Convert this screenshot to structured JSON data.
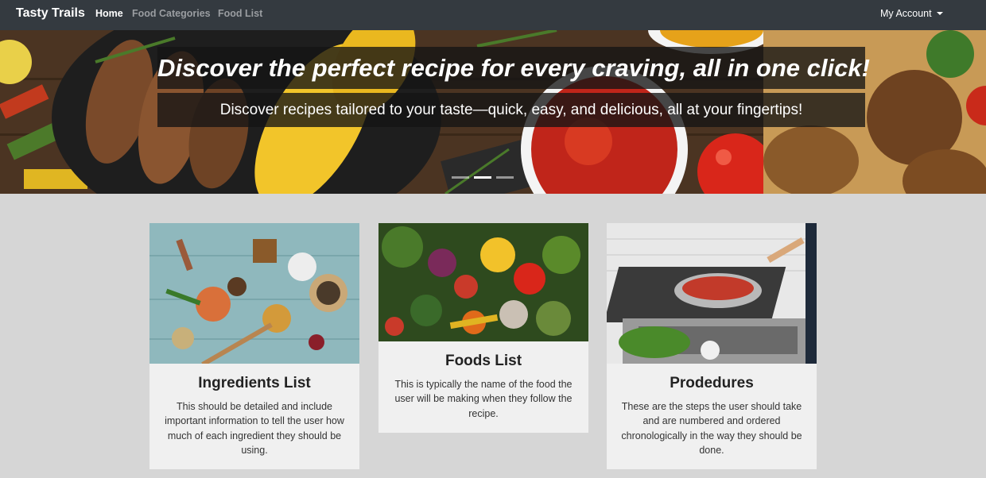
{
  "navbar": {
    "brand": "Tasty Trails",
    "links": [
      {
        "label": "Home",
        "active": true
      },
      {
        "label": "Food Categories",
        "active": false
      },
      {
        "label": "Food List",
        "active": false
      }
    ],
    "account_label": "My Account"
  },
  "hero": {
    "title": "Discover the perfect recipe for every craving, all in one click!",
    "subtitle": "Discover recipes tailored to your taste—quick, easy, and delicious, all at your fingertips!",
    "slide_count": 3,
    "active_slide": 1
  },
  "cards": [
    {
      "title": "Ingredients List",
      "text": "This should be detailed and include important information to tell the user how much of each ingredient they should be using.",
      "image_icon": "spices-photo-icon"
    },
    {
      "title": "Foods List",
      "text": "This is typically the name of the food the user will be making when they follow the recipe.",
      "image_icon": "vegetables-photo-icon"
    },
    {
      "title": "Prodedures",
      "text": "These are the steps the user should take and are numbered and ordered chronologically in the way they should be done.",
      "image_icon": "cooking-stove-photo-icon"
    }
  ],
  "colors": {
    "navbar_bg": "#343a40",
    "page_bg": "#d6d6d6",
    "card_bg": "#f0f0f0",
    "caption_bg": "#141414"
  }
}
